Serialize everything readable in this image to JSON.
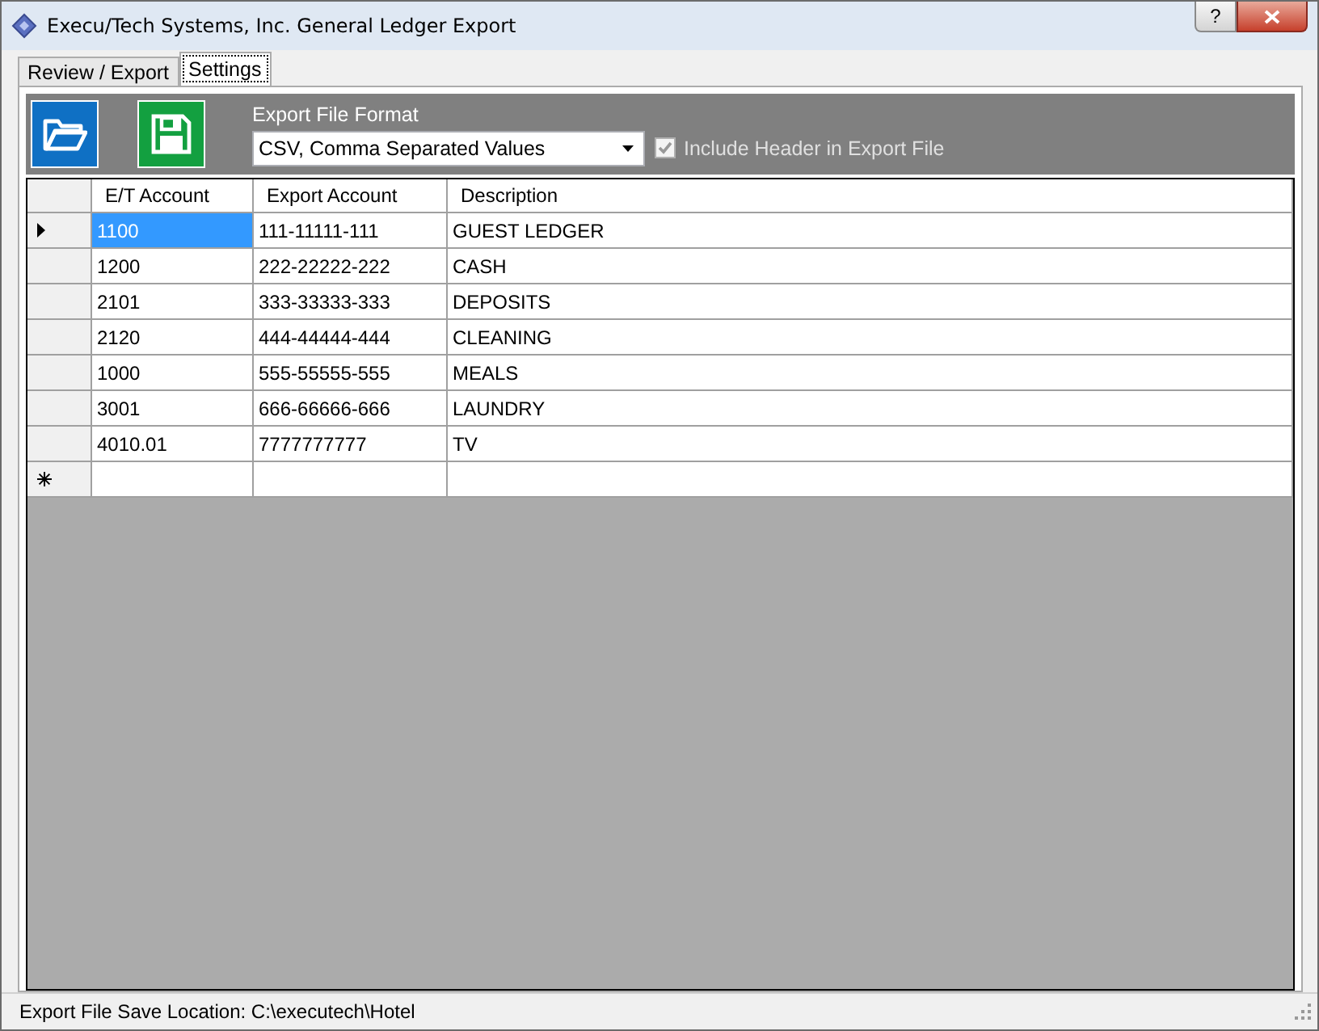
{
  "window": {
    "title": "Execu/Tech Systems, Inc. General Ledger Export",
    "help_glyph": "?"
  },
  "tabs": [
    {
      "label": "Review / Export",
      "selected": false
    },
    {
      "label": "Settings",
      "selected": true
    }
  ],
  "toolbar": {
    "format_label": "Export File Format",
    "format_value": "CSV, Comma Separated Values",
    "include_header": {
      "label": "Include Header in Export File",
      "checked": true,
      "disabled": true
    }
  },
  "table": {
    "columns": [
      "E/T Account",
      "Export Account",
      "Description"
    ],
    "rows": [
      {
        "cells": [
          "1100",
          "111-11111-111",
          "GUEST LEDGER"
        ],
        "selected": true
      },
      {
        "cells": [
          "1200",
          "222-22222-222",
          "CASH"
        ],
        "selected": false
      },
      {
        "cells": [
          "2101",
          "333-33333-333",
          "DEPOSITS"
        ],
        "selected": false
      },
      {
        "cells": [
          "2120",
          "444-44444-444",
          "CLEANING"
        ],
        "selected": false
      },
      {
        "cells": [
          "1000",
          "555-55555-555",
          "MEALS"
        ],
        "selected": false
      },
      {
        "cells": [
          "3001",
          "666-66666-666",
          "LAUNDRY"
        ],
        "selected": false
      },
      {
        "cells": [
          "4010.01",
          "7777777777",
          "TV"
        ],
        "selected": false
      }
    ]
  },
  "status_bar": "Export File Save Location: C:\\executech\\Hotel"
}
